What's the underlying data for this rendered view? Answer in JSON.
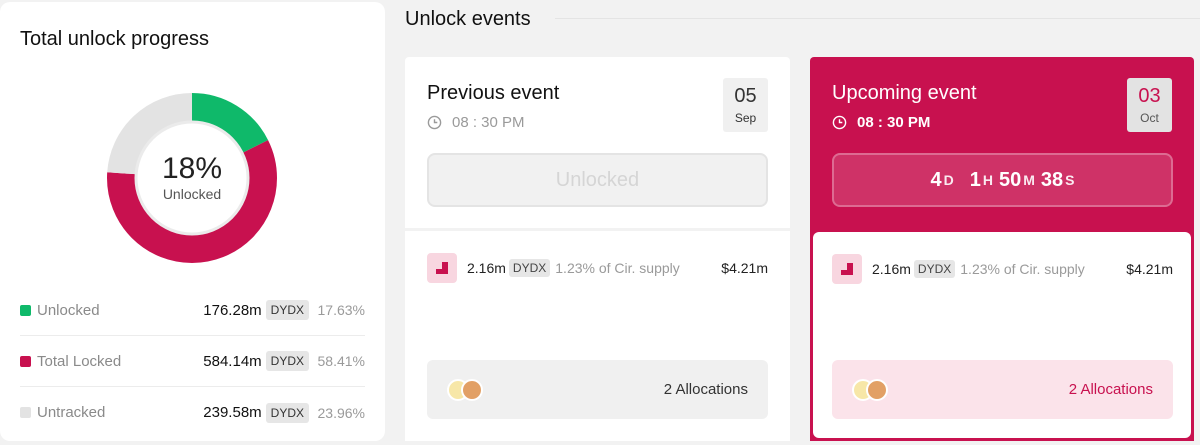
{
  "progress": {
    "title": "Total unlock progress",
    "center_percent": "18%",
    "center_label": "Unlocked",
    "segments": [
      {
        "name": "Unlocked",
        "fraction": 0.1763,
        "color": "#0fb96a"
      },
      {
        "name": "Total Locked",
        "fraction": 0.5841,
        "color": "#c8114f"
      },
      {
        "name": "Untracked",
        "fraction": 0.2396,
        "color": "#e3e3e3"
      }
    ],
    "legend": [
      {
        "label": "Unlocked",
        "amount": "176.28m",
        "token": "DYDX",
        "percent": "17.63%",
        "color": "#0fb96a"
      },
      {
        "label": "Total Locked",
        "amount": "584.14m",
        "token": "DYDX",
        "percent": "58.41%",
        "color": "#c8114f"
      },
      {
        "label": "Untracked",
        "amount": "239.58m",
        "token": "DYDX",
        "percent": "23.96%",
        "color": "#e3e3e3"
      }
    ]
  },
  "events": {
    "title": "Unlock events",
    "previous": {
      "name": "Previous event",
      "time": "08 : 30 PM",
      "day": "05",
      "month": "Sep",
      "status": "Unlocked",
      "amount": "2.16m",
      "token": "DYDX",
      "supply": "1.23% of Cir. supply",
      "usd": "$4.21m",
      "allocations": "2 Allocations"
    },
    "upcoming": {
      "name": "Upcoming event",
      "time": "08 : 30 PM",
      "day": "03",
      "month": "Oct",
      "countdown": {
        "days": "4",
        "days_unit": "D",
        "hours": "1",
        "hours_unit": "H",
        "minutes": "50",
        "minutes_unit": "M",
        "seconds": "38",
        "seconds_unit": "S"
      },
      "amount": "2.16m",
      "token": "DYDX",
      "supply": "1.23% of Cir. supply",
      "usd": "$4.21m",
      "allocations": "2 Allocations"
    }
  },
  "colors": {
    "accent": "#c8114f",
    "green": "#0fb96a",
    "grey": "#e3e3e3"
  }
}
